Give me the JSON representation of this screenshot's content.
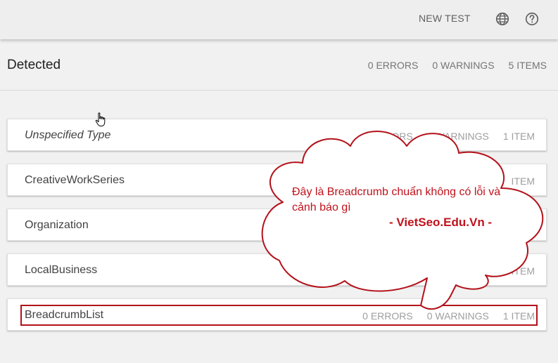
{
  "header": {
    "new_test_label": "NEW TEST",
    "globe_icon": "globe-icon",
    "help_icon": "help-circle-icon"
  },
  "summary": {
    "title": "Detected",
    "errors": "0 ERRORS",
    "warnings": "0 WARNINGS",
    "items": "5 ITEMS"
  },
  "types": [
    {
      "label": "Unspecified Type",
      "errors": "0 ERRORS",
      "warnings": "0 WARNINGS",
      "items": "1 ITEM"
    },
    {
      "label": "CreativeWorkSeries",
      "errors": "",
      "warnings": "",
      "items": "ITEM"
    },
    {
      "label": "Organization",
      "errors": "",
      "warnings": "",
      "items": ""
    },
    {
      "label": "LocalBusiness",
      "errors": "",
      "warnings": "",
      "items": "1 ITEM"
    },
    {
      "label": "BreadcrumbList",
      "errors": "0 ERRORS",
      "warnings": "0 WARNINGS",
      "items": "1 ITEM"
    }
  ],
  "annotation": {
    "text": "Đây là Breadcrumb chuẩn không có lỗi và cảnh báo gì",
    "signature": "- VietSeo.Edu.Vn -",
    "color": "#c0121c"
  }
}
